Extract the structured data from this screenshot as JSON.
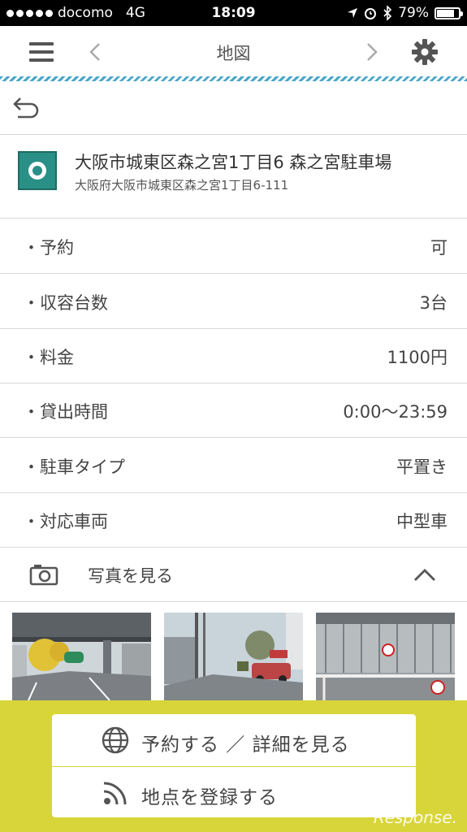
{
  "status": {
    "carrier": "docomo",
    "network": "4G",
    "time": "18:09",
    "battery": "79%",
    "battery_level": 0.79
  },
  "nav": {
    "title": "地図"
  },
  "place": {
    "name": "大阪市城東区森之宮1丁目6 森之宮駐車場",
    "address": "大阪府大阪市城東区森之宮1丁目6-111"
  },
  "details": [
    {
      "label": "・予約",
      "value": "可"
    },
    {
      "label": "・収容台数",
      "value": "3台"
    },
    {
      "label": "・料金",
      "value": "1100円"
    },
    {
      "label": "・貸出時間",
      "value": "0:00〜23:59"
    },
    {
      "label": "・駐車タイプ",
      "value": "平置き"
    },
    {
      "label": "・対応車両",
      "value": "中型車"
    }
  ],
  "photos": {
    "label": "写真を見る"
  },
  "actions": {
    "reserve_label": "予約する ／ 詳細を見る",
    "register_label": "地点を登録する"
  },
  "watermark": "Response."
}
